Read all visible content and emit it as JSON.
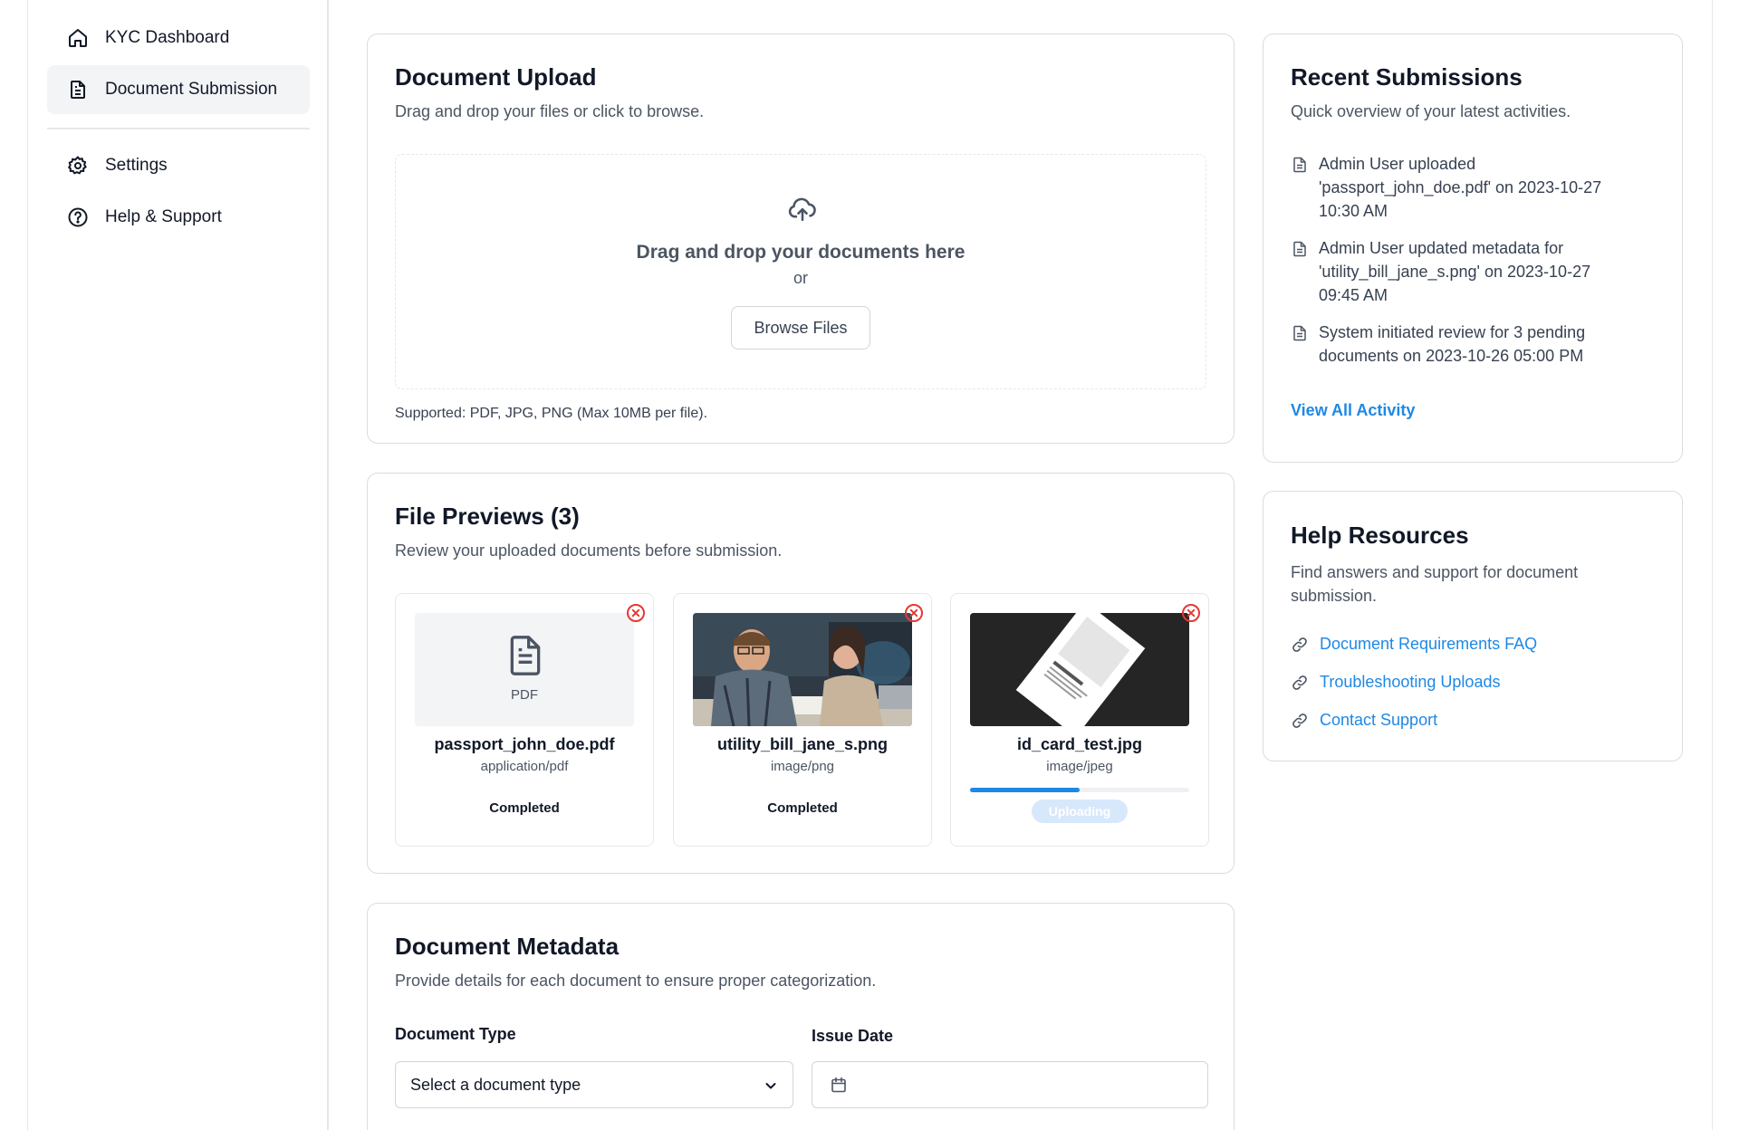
{
  "sidebar": {
    "items": [
      {
        "label": "KYC Dashboard",
        "icon": "home-icon"
      },
      {
        "label": "Document Submission",
        "icon": "document-icon",
        "active": true
      },
      {
        "label": "Settings",
        "icon": "gear-icon"
      },
      {
        "label": "Help & Support",
        "icon": "help-circle-icon"
      }
    ]
  },
  "upload": {
    "title": "Document Upload",
    "subtitle": "Drag and drop your files or click to browse.",
    "drop_title": "Drag and drop your documents here",
    "drop_or": "or",
    "browse_label": "Browse Files",
    "supported": "Supported: PDF, JPG, PNG (Max 10MB per file)."
  },
  "previews": {
    "title": "File Previews (3)",
    "subtitle": "Review your uploaded documents before submission.",
    "files": [
      {
        "name": "passport_john_doe.pdf",
        "type": "application/pdf",
        "status": "Completed",
        "thumb_label": "PDF"
      },
      {
        "name": "utility_bill_jane_s.png",
        "type": "image/png",
        "status": "Completed"
      },
      {
        "name": "id_card_test.jpg",
        "type": "image/jpeg",
        "status": "Uploading",
        "progress": 0.5
      }
    ]
  },
  "metadata": {
    "title": "Document Metadata",
    "subtitle": "Provide details for each document to ensure proper categorization.",
    "doc_type_label": "Document Type",
    "doc_type_value": "Select a document type",
    "issue_date_label": "Issue Date",
    "issue_date_value": ""
  },
  "recent": {
    "title": "Recent Submissions",
    "subtitle": "Quick overview of your latest activities.",
    "items": [
      {
        "line1": "Admin User uploaded",
        "line2": "'passport_john_doe.pdf' on 2023-10-27",
        "line3": "10:30 AM"
      },
      {
        "line1": "Admin User updated metadata for",
        "line2": "'utility_bill_jane_s.png' on 2023-10-27",
        "line3": "09:45 AM"
      },
      {
        "line1": "System initiated review for 3 pending",
        "line2": "documents on 2023-10-26 05:00 PM"
      }
    ],
    "view_all": "View All Activity"
  },
  "help": {
    "title": "Help Resources",
    "subtitle_line1": "Find answers and support for document",
    "subtitle_line2": "submission.",
    "links": [
      "Document Requirements FAQ",
      "Troubleshooting Uploads",
      "Contact Support"
    ]
  },
  "colors": {
    "accent": "#1e88e5",
    "remove": "#e53935",
    "active_nav_bg": "#f3f4f6"
  }
}
